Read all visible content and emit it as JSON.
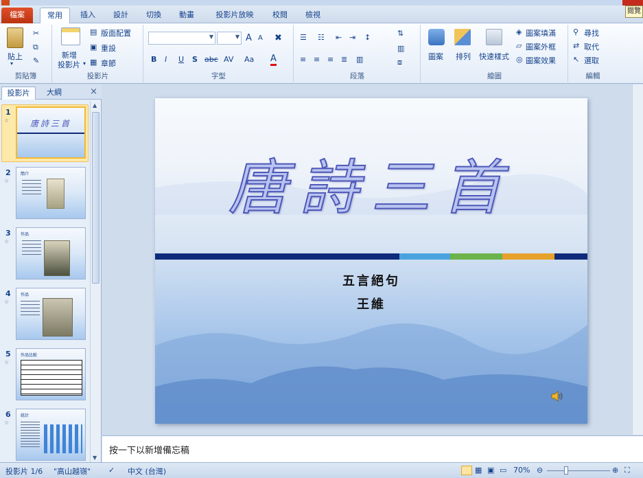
{
  "ribbon_tabs": [
    "檔案",
    "常用",
    "插入",
    "設計",
    "切換",
    "動畫",
    "投影片放映",
    "校閱",
    "檢視"
  ],
  "help_popup": "閱覽",
  "groups": {
    "clipboard": {
      "label": "剪貼簿",
      "paste": "貼上"
    },
    "slides": {
      "label": "投影片",
      "new_slide": "新增",
      "new_slide2": "投影片",
      "layout": "版面配置",
      "reset": "重設",
      "section": "章節"
    },
    "font": {
      "label": "字型",
      "bold": "B",
      "italic": "I",
      "underline": "U",
      "shadow": "S",
      "strike": "abc",
      "spacing": "AV",
      "case": "Aa",
      "color": "A",
      "grow": "A",
      "shrink": "A"
    },
    "paragraph": {
      "label": "段落"
    },
    "drawing": {
      "label": "繪圖",
      "shapes": "圖案",
      "arrange": "排列",
      "quick_styles": "快速樣式",
      "fill": "圖案填滿",
      "outline": "圖案外框",
      "effects": "圖案效果"
    },
    "editing": {
      "label": "編輯",
      "find": "尋找",
      "replace": "取代",
      "select": "選取"
    }
  },
  "left_pane": {
    "tab_slides": "投影片",
    "tab_outline": "大綱",
    "close": "×",
    "thumbnails": [
      {
        "num": "1",
        "title": "唐詩三首"
      },
      {
        "num": "2",
        "title": "簡介"
      },
      {
        "num": "3",
        "title": "作品"
      },
      {
        "num": "4",
        "title": "作品"
      },
      {
        "num": "5",
        "title": "作品比較"
      },
      {
        "num": "6",
        "title": "統計"
      }
    ]
  },
  "slide": {
    "title": "唐詩三首",
    "subtitle": "五言絕句",
    "author": "王維",
    "bar_colors": [
      "#0f2a7a",
      "#4aa3df",
      "#6cb34a",
      "#e6a12b",
      "#0f2a7a"
    ]
  },
  "notes_placeholder": "按一下以新增備忘稿",
  "status": {
    "slide_info": "投影片 1/6",
    "theme": "\"高山越嶺\"",
    "language": "中文 (台灣)",
    "zoom": "70%"
  }
}
